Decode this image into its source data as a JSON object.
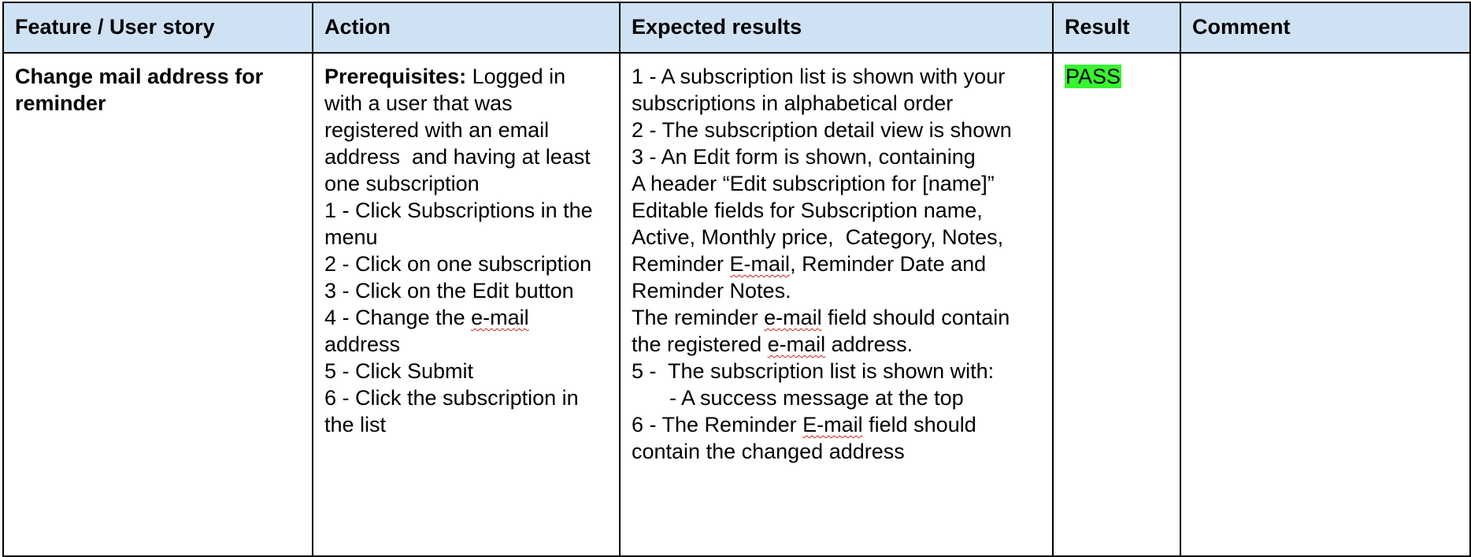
{
  "table": {
    "headers": {
      "feature": "Feature / User story",
      "action": "Action",
      "expected": "Expected results",
      "result": "Result",
      "comment": "Comment"
    },
    "row": {
      "feature": "Change mail address for reminder",
      "action": {
        "prereq_label": "Prerequisites:",
        "prereq_text": " Logged in with a user that was registered with an email address  and having at least one subscription",
        "step1": "1 - Click Subscriptions in the menu",
        "step2": "2 - Click on one subscription",
        "step3": "3 - Click on the Edit button",
        "step4_pre": "4 - Change the ",
        "step4_word": "e-mail",
        "step4_post": " address",
        "step5": "5 - Click Submit",
        "step6": "6 - Click the subscription in the list"
      },
      "expected": {
        "line1": "1 - A subscription list is shown with your subscriptions in alphabetical order",
        "line2": "2 - The subscription detail view is shown",
        "line3": "3 - An Edit form is shown, containing",
        "line4": "A header “Edit subscription for [name]”",
        "line5_pre": "Editable fields for Subscription name, Active, Monthly price,  Category, Notes, Reminder ",
        "line5_word": "E-mail",
        "line5_post": ", Reminder Date and Reminder Notes.",
        "line6_pre": "The reminder ",
        "line6_word1": "e-mail",
        "line6_mid": " field should contain the registered ",
        "line6_word2": "e-mail",
        "line6_post": " address.",
        "line7": "5 -  The subscription list is shown with:",
        "line8": "- A success message at the top",
        "line9_pre": "6 - The Reminder ",
        "line9_word": "E-mail",
        "line9_post": " field should contain the changed address"
      },
      "result": "PASS",
      "comment": ""
    }
  },
  "colors": {
    "header_bg": "#cfe2f3",
    "pass_highlight": "#35f52f",
    "border": "#000000"
  }
}
